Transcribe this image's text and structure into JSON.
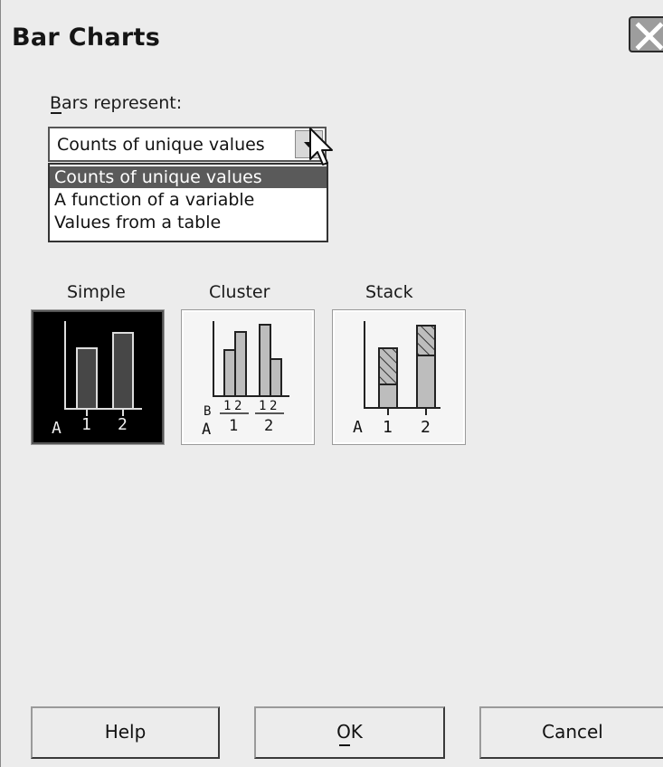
{
  "window": {
    "title": "Bar Charts"
  },
  "bars_represent": {
    "label": "Bars represent:",
    "selected": "Counts of unique values",
    "options": [
      "Counts of unique values",
      "A function of a variable",
      "Values from a table"
    ]
  },
  "chart_types": [
    {
      "label": "Simple",
      "selected": true,
      "axis_label": "A",
      "ticks": [
        "1",
        "2"
      ]
    },
    {
      "label": "Cluster",
      "selected": false,
      "inner_label": "B",
      "outer_label": "A",
      "inner_ticks": [
        "1",
        "2",
        "1",
        "2"
      ],
      "ticks": [
        "1",
        "2"
      ]
    },
    {
      "label": "Stack",
      "selected": false,
      "axis_label": "A",
      "ticks": [
        "1",
        "2"
      ]
    }
  ],
  "buttons": {
    "help": "Help",
    "ok": "OK",
    "cancel": "Cancel"
  },
  "icons": {
    "close": "close-icon",
    "dropdown": "chevron-down-icon",
    "cursor": "arrow-cursor-icon"
  }
}
